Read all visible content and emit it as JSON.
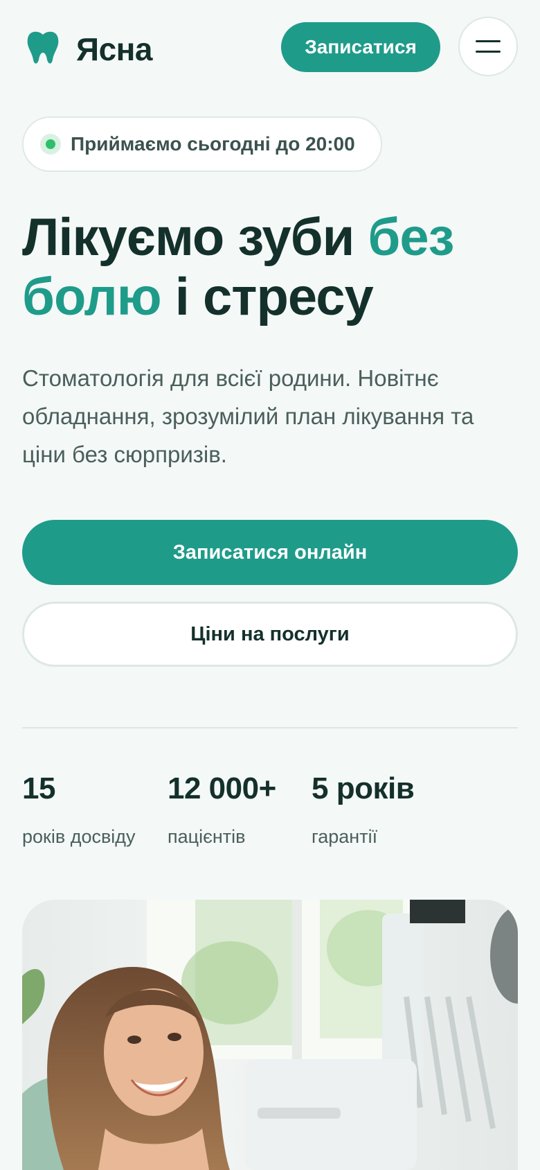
{
  "header": {
    "brand": "Ясна",
    "book_label": "Записатися",
    "menu_icon": "menu-icon",
    "logo_icon": "tooth-icon"
  },
  "status": {
    "text": "Приймаємо сьогодні до 20:00",
    "dot_color": "#2ebf6a"
  },
  "hero": {
    "title_part1": "Лікуємо зуби ",
    "title_accent": "без болю",
    "title_part2": " і стресу",
    "lead": "Стоматологія для всієї родини. Новітнє обладнання, зрозумілий план лікування та ціни без сюрпризів.",
    "cta_primary": "Записатися онлайн",
    "cta_secondary": "Ціни на послуги"
  },
  "stats": [
    {
      "value": "15",
      "label": "років досвіду"
    },
    {
      "value": "12 000+",
      "label": "пацієнтів"
    },
    {
      "value": "5 років",
      "label": "гарантії"
    }
  ],
  "colors": {
    "accent": "#1f9b8a",
    "text": "#14302b",
    "background": "#f4f8f7"
  }
}
